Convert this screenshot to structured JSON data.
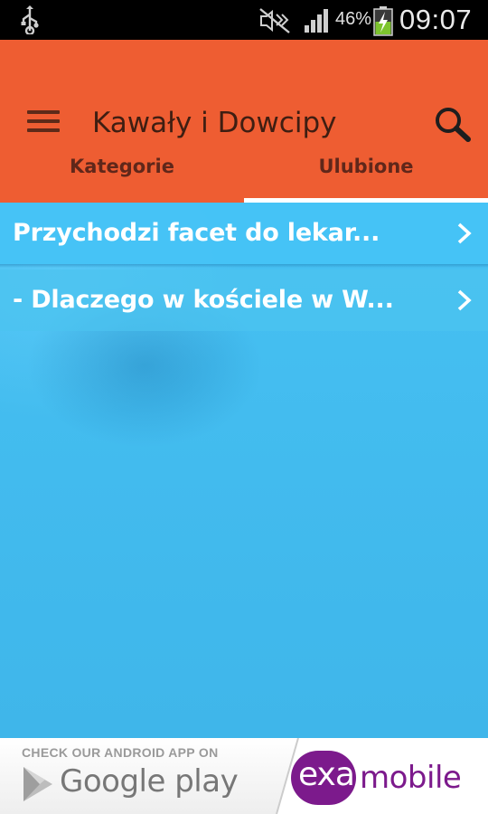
{
  "status_bar": {
    "battery_percent": "46%",
    "time": "09:07",
    "icons": [
      "usb-icon",
      "mute-icon",
      "signal-icon",
      "battery-charging-icon"
    ]
  },
  "app_bar": {
    "title": "Kawały i Dowcipy",
    "menu_icon": "hamburger-menu-icon",
    "search_icon": "search-icon",
    "color": "#ee5d32"
  },
  "tabs": [
    {
      "label": "Kategorie",
      "selected": false
    },
    {
      "label": "Ulubione",
      "selected": true
    }
  ],
  "list": {
    "items": [
      {
        "title": "Przychodzi facet do lekar..."
      },
      {
        "title": "- Dlaczego w kościele w W..."
      }
    ],
    "background": "#42bbee"
  },
  "ad_banner": {
    "headline": "CHECK OUR ANDROID APP ON",
    "store": "Google play",
    "brand_exa": "exa",
    "brand_mobile": "mobile",
    "brand_color": "#7c1a8c"
  }
}
